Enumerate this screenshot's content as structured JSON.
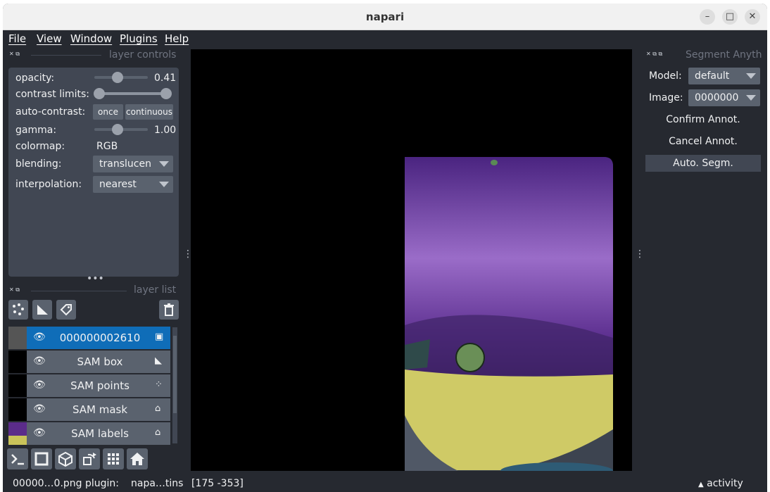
{
  "window": {
    "title": "napari"
  },
  "menu": [
    {
      "label": "File"
    },
    {
      "label": "View"
    },
    {
      "label": "Window"
    },
    {
      "label": "Plugins"
    },
    {
      "label": "Help"
    }
  ],
  "layer_controls": {
    "header": "layer controls",
    "opacity": {
      "label": "opacity:",
      "value": "0.41",
      "fraction": 0.41
    },
    "contrast": {
      "label": "contrast limits:"
    },
    "auto_contrast": {
      "label": "auto-contrast:",
      "once": "once",
      "continuous": "continuous"
    },
    "gamma": {
      "label": "gamma:",
      "value": "1.00"
    },
    "colormap": {
      "label": "colormap:",
      "value": "RGB"
    },
    "blending": {
      "label": "blending:",
      "value": "translucen"
    },
    "interpolation": {
      "label": "interpolation:",
      "value": "nearest"
    }
  },
  "layer_list": {
    "header": "layer list",
    "layers": [
      {
        "name": "000000002610",
        "type_icon": "image-icon",
        "selected": true
      },
      {
        "name": "SAM box",
        "type_icon": "shapes-icon",
        "selected": false
      },
      {
        "name": "SAM points",
        "type_icon": "points-icon",
        "selected": false
      },
      {
        "name": "SAM mask",
        "type_icon": "labels-icon",
        "selected": false
      },
      {
        "name": "SAM labels",
        "type_icon": "labels-icon",
        "selected": false
      }
    ]
  },
  "plugin": {
    "header": "Segment Anyth",
    "model_label": "Model:",
    "model_value": "default",
    "image_label": "Image:",
    "image_value": "0000000",
    "confirm": "Confirm Annot.",
    "cancel": "Cancel Annot.",
    "auto": "Auto. Segm."
  },
  "status": {
    "file": "00000…0.png",
    "plugin_label": "plugin:",
    "plugin_value": "napa…tins",
    "coords": "[175 -353]",
    "activity": "activity"
  },
  "colors": {
    "background": "#262930",
    "panel": "#414753",
    "control": "#5a626e",
    "selected": "#0f6db8",
    "label_purple": "#8a4fc4",
    "label_yellow": "#d9d46a"
  }
}
